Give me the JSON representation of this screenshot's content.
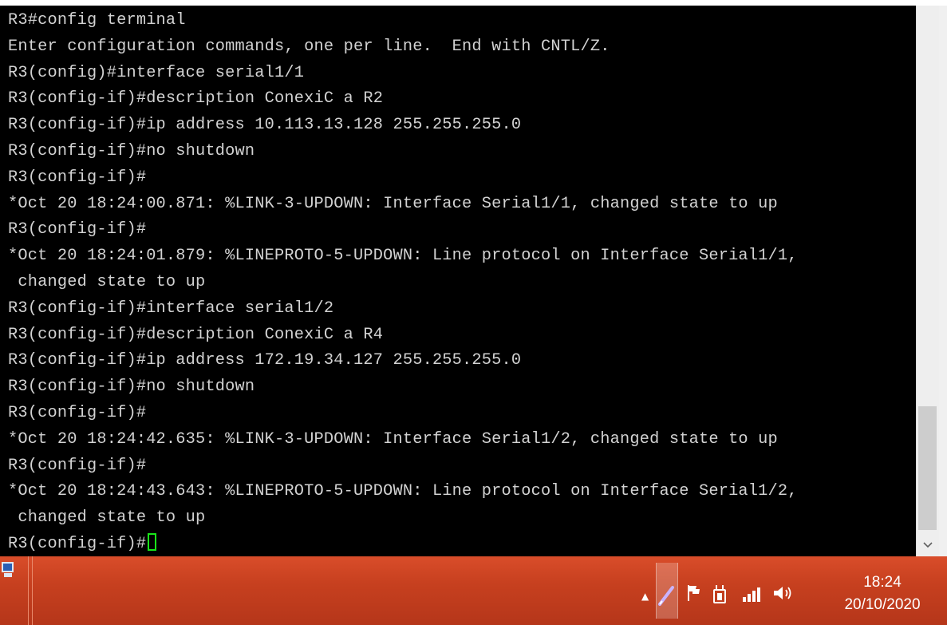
{
  "terminal": {
    "lines": [
      "R3#config terminal",
      "Enter configuration commands, one per line.  End with CNTL/Z.",
      "R3(config)#interface serial1/1",
      "R3(config-if)#description ConexiC a R2",
      "R3(config-if)#ip address 10.113.13.128 255.255.255.0",
      "R3(config-if)#no shutdown",
      "R3(config-if)#",
      "*Oct 20 18:24:00.871: %LINK-3-UPDOWN: Interface Serial1/1, changed state to up",
      "R3(config-if)#",
      "*Oct 20 18:24:01.879: %LINEPROTO-5-UPDOWN: Line protocol on Interface Serial1/1,",
      " changed state to up",
      "R3(config-if)#interface serial1/2",
      "R3(config-if)#description ConexiC a R4",
      "R3(config-if)#ip address 172.19.34.127 255.255.255.0",
      "R3(config-if)#no shutdown",
      "R3(config-if)#",
      "*Oct 20 18:24:42.635: %LINK-3-UPDOWN: Interface Serial1/2, changed state to up",
      "R3(config-if)#",
      "*Oct 20 18:24:43.643: %LINEPROTO-5-UPDOWN: Line protocol on Interface Serial1/2,",
      " changed state to up"
    ],
    "prompt": "R3(config-if)#",
    "text_color": "#d2d2d2",
    "background_color": "#000000",
    "cursor_color": "#19e619"
  },
  "scrollbar": {
    "down_arrow_icon": "chevron-down-icon"
  },
  "taskbar": {
    "color": "#c7401f",
    "app_icon": "computer-icon",
    "tray": {
      "icons": [
        "chevron-up-icon",
        "pen-icon",
        "flag-icon",
        "power-icon",
        "signal-icon",
        "volume-icon"
      ]
    },
    "clock": {
      "time": "18:24",
      "date": "20/10/2020"
    }
  }
}
